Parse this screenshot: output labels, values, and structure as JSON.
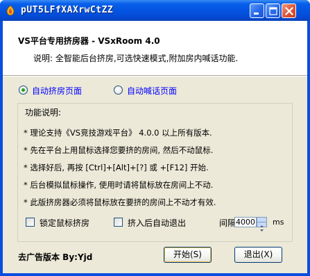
{
  "window": {
    "title": "pUT5LFfXAXrwCtZZ",
    "icon": "app-icon",
    "controls": [
      "minimize-icon",
      "maximize-icon",
      "close-icon"
    ]
  },
  "header": {
    "title": "VS平台专用挤房器 - VSxRoom 4.0",
    "description": "说明: 全智能后台挤房,可选快速模式,附加房内喊话功能."
  },
  "modes": [
    {
      "label": "自动挤房页面",
      "selected": true
    },
    {
      "label": "自动喊话页面",
      "selected": false
    }
  ],
  "group": {
    "title": "功能说明:",
    "lines": [
      "* 理论支持《VS竞技游戏平台》 4.0.0 以上所有版本.",
      "* 先在平台上用鼠标选择您要挤的房间, 然后不动鼠标.",
      "* 选择好后, 再按 [Ctrl]+[Alt]+[?] 或 +[F12] 开始.",
      "* 后台模拟鼠标操作, 使用时请将鼠标放在房间上不动.",
      "* 此版挤房器必须将鼠标放在要挤的房间上不动才有效."
    ]
  },
  "options": {
    "lock_mouse_label": "锁定鼠标挤房",
    "lock_mouse_checked": false,
    "auto_exit_label": "挤入后自动退出",
    "auto_exit_checked": false,
    "interval_label": "间隔",
    "interval_value": "4000",
    "interval_unit": "ms"
  },
  "footer": {
    "credit": "去广告版本 By:Yjd",
    "start_label": "开始(S)",
    "exit_label": "退出(X)"
  },
  "colors": {
    "titlebar": "#0453e0",
    "client_bg": "#ece9d8",
    "link_text": "#0000ff",
    "radio_dot": "#21a121"
  }
}
